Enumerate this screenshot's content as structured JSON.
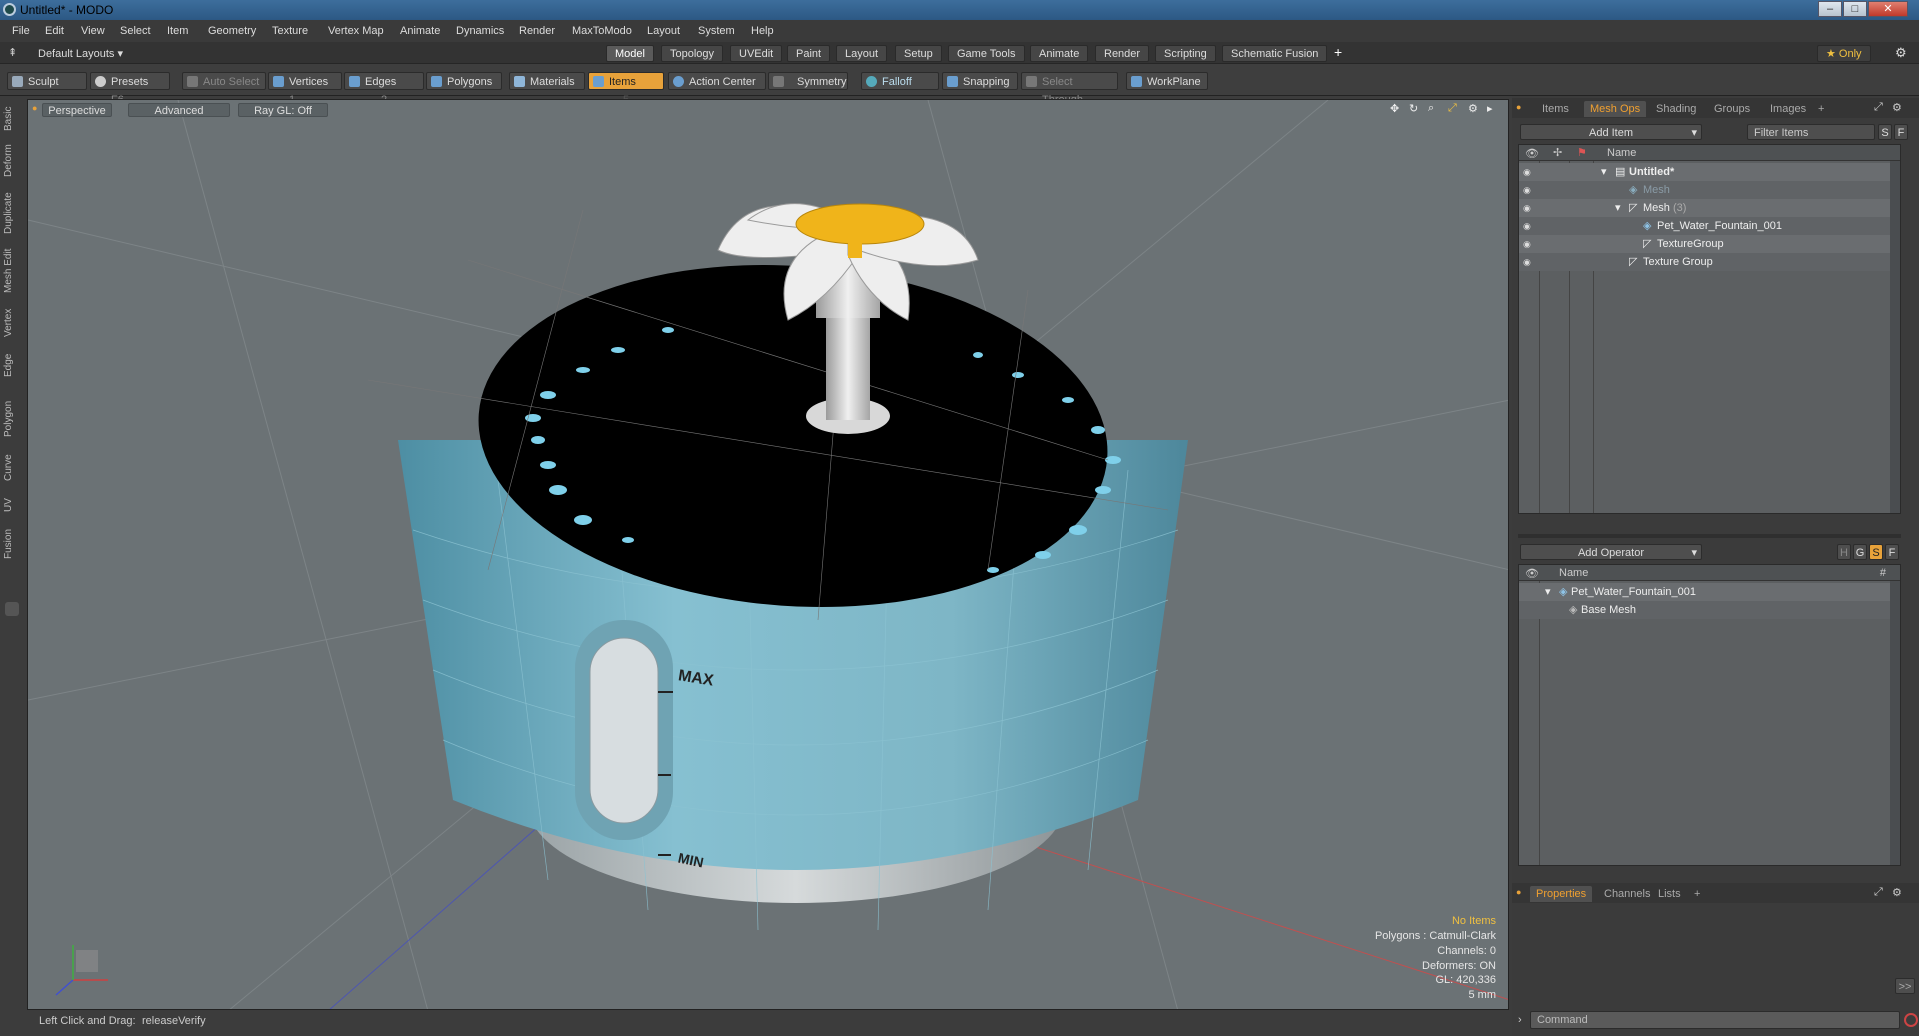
{
  "window": {
    "title": "Untitled* - MODO",
    "min": "–",
    "max": "□",
    "close": "✕"
  },
  "menu": [
    "File",
    "Edit",
    "View",
    "Select",
    "Item",
    "Geometry",
    "Texture",
    "Vertex Map",
    "Animate",
    "Dynamics",
    "Render",
    "MaxToModo",
    "Layout",
    "System",
    "Help"
  ],
  "layout_selector": "Default Layouts ▾",
  "mode_tabs": [
    "Model",
    "Topology",
    "UVEdit",
    "Paint",
    "Layout",
    "Setup",
    "Game Tools",
    "Animate",
    "Render",
    "Scripting",
    "Schematic Fusion"
  ],
  "mode_add": "+",
  "only_label": "★  Only",
  "toolbar": {
    "sculpt": "Sculpt",
    "presets": "Presets",
    "presets_key": "F6",
    "auto_select": "Auto Select",
    "vertices": "Vertices",
    "vertices_n": "1",
    "edges": "Edges",
    "edges_n": "2",
    "polygons": "Polygons",
    "materials": "Materials",
    "items": "Items",
    "items_n": "5",
    "action_center": "Action Center",
    "symmetry": "Symmetry",
    "falloff": "Falloff",
    "snapping": "Snapping",
    "select_through": "Select Through",
    "workplane": "WorkPlane"
  },
  "left_tabs": [
    "Basic",
    "Deform",
    "Duplicate",
    "Mesh Edit",
    "Vertex",
    "Edge",
    "Polygon",
    "Curve",
    "UV",
    "Fusion"
  ],
  "viewport": {
    "perspective": "Perspective",
    "advanced": "Advanced",
    "raygl": "Ray GL: Off",
    "label_max": "MAX",
    "label_min": "MIN",
    "info": {
      "no_items": "No Items",
      "polygons": "Polygons : Catmull-Clark",
      "channels": "Channels: 0",
      "deformers": "Deformers: ON",
      "gl": "GL: 420,336",
      "scale": "5 mm"
    }
  },
  "status": {
    "left": "Left Click and Drag:",
    "value": "releaseVerify"
  },
  "items_panel": {
    "tabs": [
      "Items",
      "Mesh Ops",
      "Shading",
      "Groups",
      "Images",
      "+"
    ],
    "active_tab": "Mesh Ops",
    "add_item": "Add Item",
    "filter": "Filter Items",
    "s": "S",
    "f": "F",
    "col_name": "Name",
    "rows": [
      {
        "label": "Untitled*",
        "bold": true,
        "indent": 0
      },
      {
        "label": "Mesh",
        "dim": true,
        "indent": 1
      },
      {
        "label": "Mesh",
        "count": "(3)",
        "indent": 1
      },
      {
        "label": "Pet_Water_Fountain_001",
        "indent": 2
      },
      {
        "label": "TextureGroup",
        "indent": 2
      },
      {
        "label": "Texture Group",
        "indent": 1
      }
    ]
  },
  "meshops_panel": {
    "add_operator": "Add Operator",
    "h": "H",
    "g": "G",
    "s": "S",
    "f": "F",
    "col_name": "Name",
    "col_hash": "#",
    "rows": [
      {
        "label": "Pet_Water_Fountain_001",
        "indent": 0
      },
      {
        "label": "Base Mesh",
        "indent": 1
      }
    ]
  },
  "props_panel": {
    "tabs": [
      "Properties",
      "Channels",
      "Lists",
      "+"
    ],
    "active_tab": "Properties",
    "expand": ">>",
    "command_placeholder": "Command"
  },
  "colors": {
    "accent": "#e8a23a",
    "viewport_bg": "#6b7275",
    "bowl": "#7fb3c4",
    "water": "#000000",
    "flower_center": "#f0b41a"
  }
}
